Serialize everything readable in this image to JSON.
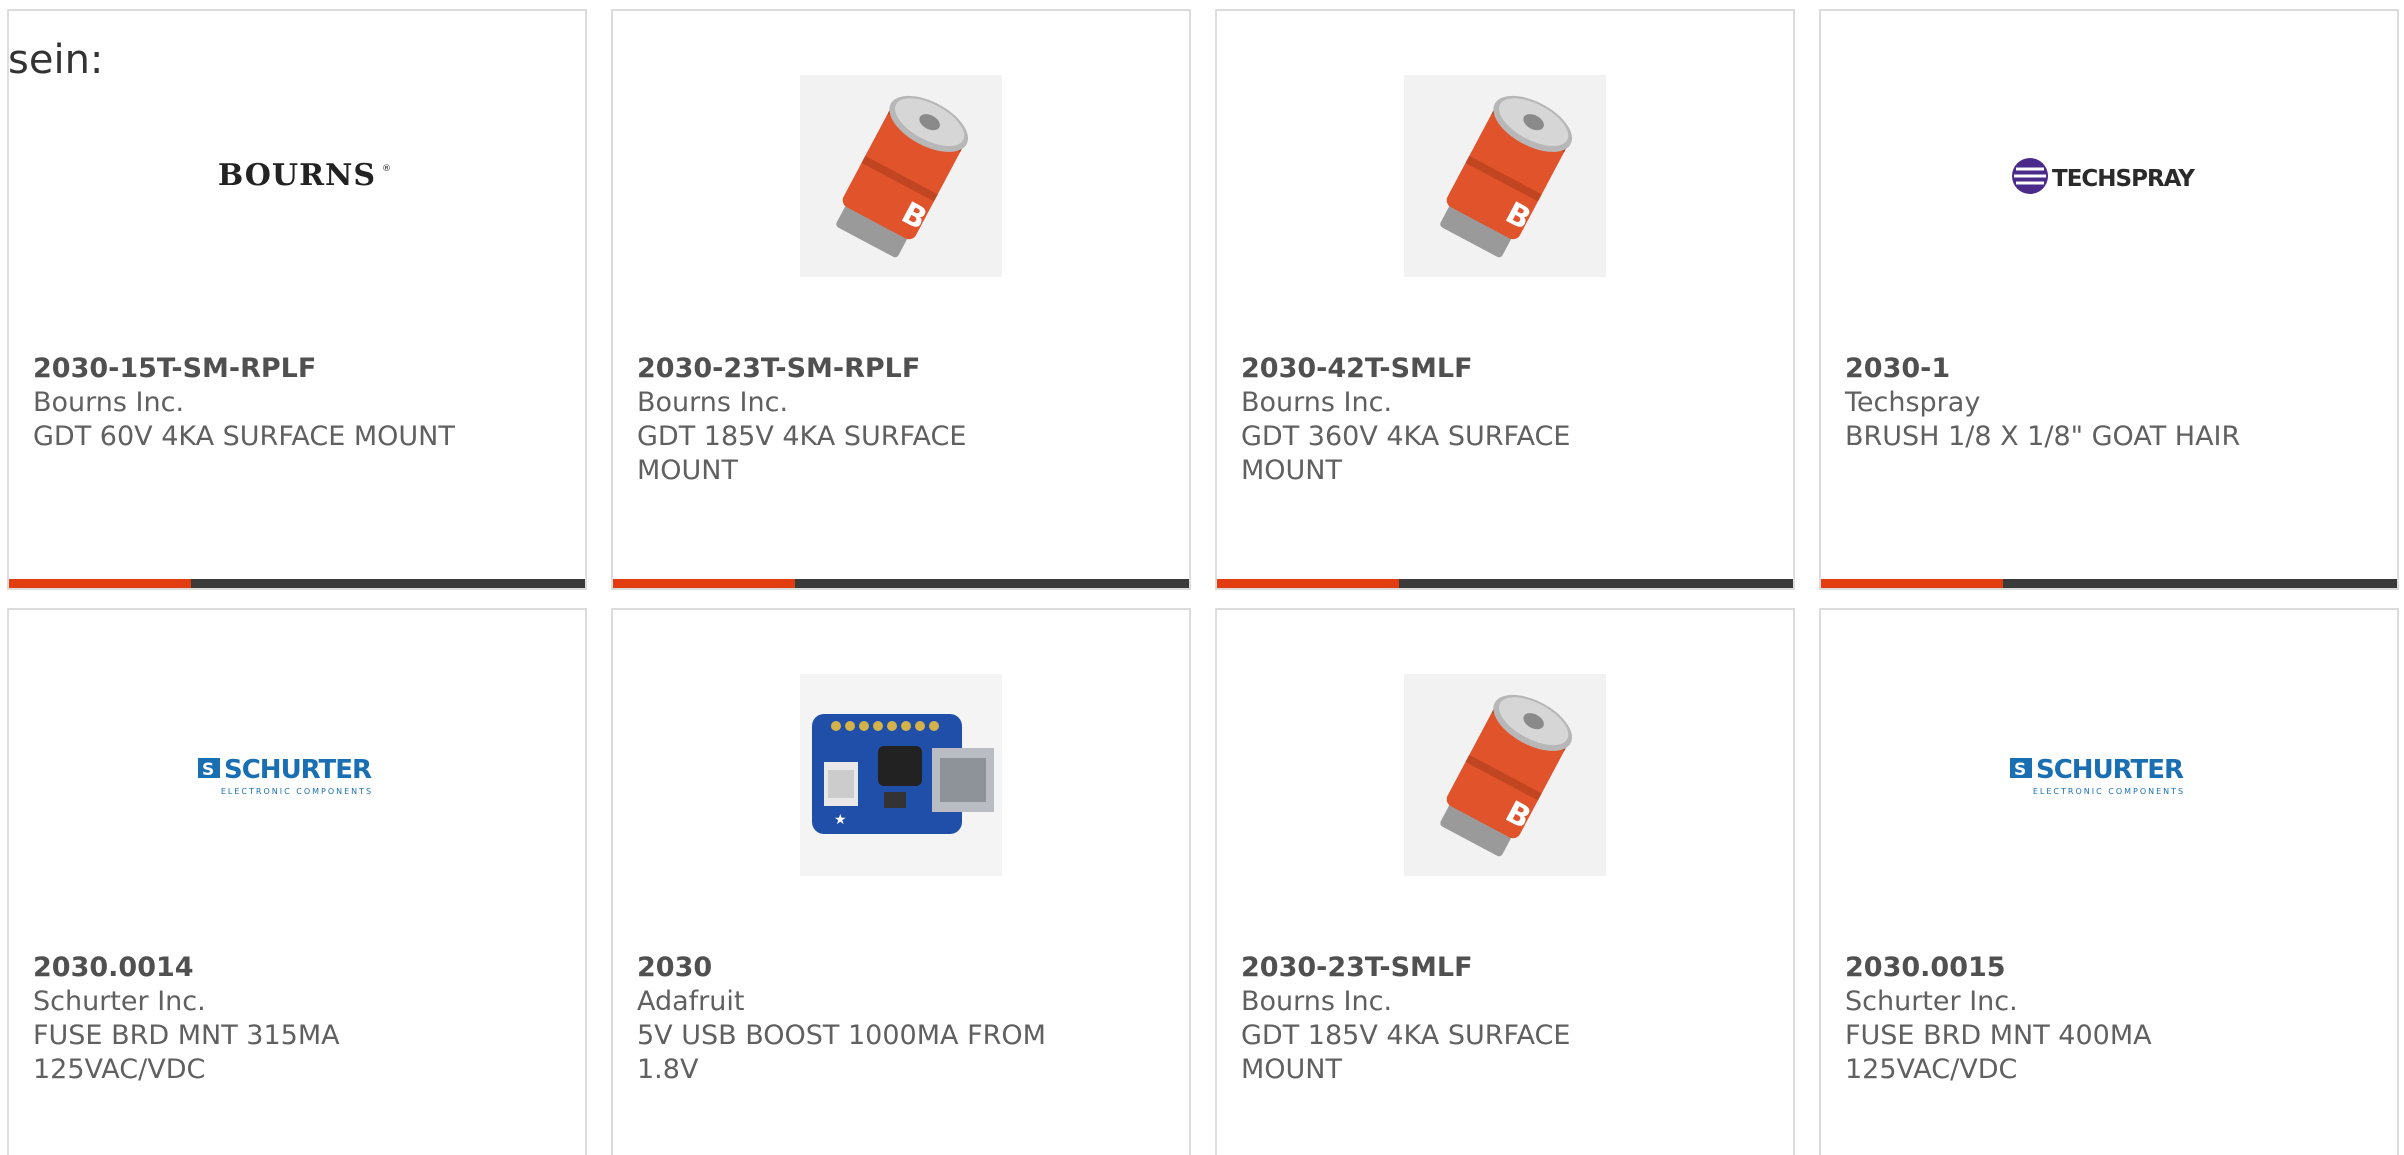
{
  "lead_text": "sein:",
  "colors": {
    "bar_dark": "#3a3a3a",
    "bar_accent": "#e23d10",
    "text": "#606060",
    "border": "#dcdcdc",
    "schurter_blue": "#1a6fb3",
    "techspray_purple": "#4a2a8a"
  },
  "products": [
    {
      "part_number": "2030-15T-SM-RPLF",
      "manufacturer": "Bourns Inc.",
      "description": "GDT 60V 4KA SURFACE MOUNT",
      "image": "bourns-logo",
      "logo_text": "BOURNS"
    },
    {
      "part_number": "2030-23T-SM-RPLF",
      "manufacturer": "Bourns Inc.",
      "description": "GDT 185V 4KA SURFACE MOUNT",
      "image": "gas-discharge-tube"
    },
    {
      "part_number": "2030-42T-SMLF",
      "manufacturer": "Bourns Inc.",
      "description": "GDT 360V 4KA SURFACE MOUNT",
      "image": "gas-discharge-tube"
    },
    {
      "part_number": "2030-1",
      "manufacturer": "Techspray",
      "description": "BRUSH 1/8 X 1/8\" GOAT HAIR",
      "image": "techspray-logo",
      "logo_text": "TECHSPRAY"
    },
    {
      "part_number": "2030.0014",
      "manufacturer": "Schurter Inc.",
      "description": "FUSE BRD MNT 315MA 125VAC/VDC",
      "image": "schurter-logo",
      "logo_text": "SCHURTER",
      "logo_subtext": "ELECTRONIC COMPONENTS"
    },
    {
      "part_number": "2030",
      "manufacturer": "Adafruit",
      "description": "5V USB BOOST 1000MA FROM 1.8V",
      "image": "usb-boost-board"
    },
    {
      "part_number": "2030-23T-SMLF",
      "manufacturer": "Bourns Inc.",
      "description": "GDT 185V 4KA SURFACE MOUNT",
      "image": "gas-discharge-tube"
    },
    {
      "part_number": "2030.0015",
      "manufacturer": "Schurter Inc.",
      "description": "FUSE BRD MNT 400MA 125VAC/VDC",
      "image": "schurter-logo",
      "logo_text": "SCHURTER",
      "logo_subtext": "ELECTRONIC COMPONENTS"
    }
  ]
}
